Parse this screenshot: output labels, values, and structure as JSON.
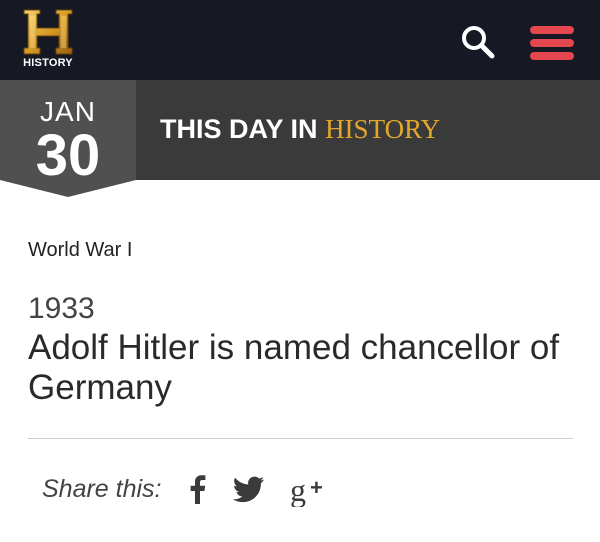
{
  "header": {
    "logo_text": "HISTORY",
    "logo_letter": "H",
    "search_icon": "search-icon",
    "menu_icon": "hamburger-menu-icon",
    "accent_color": "#e5474f",
    "background": "#161823"
  },
  "date_banner": {
    "month": "JAN",
    "day": "30",
    "title_prefix": "THIS DAY IN",
    "title_suffix": "HISTORY",
    "title_suffix_color": "#e3a82a",
    "background": "#3a3a3a"
  },
  "article": {
    "category": "World War I",
    "year": "1933",
    "headline": "Adolf Hitler is named chancellor of Germany"
  },
  "share": {
    "label": "Share this:",
    "icons": [
      "facebook-icon",
      "twitter-icon",
      "google-plus-icon"
    ]
  }
}
